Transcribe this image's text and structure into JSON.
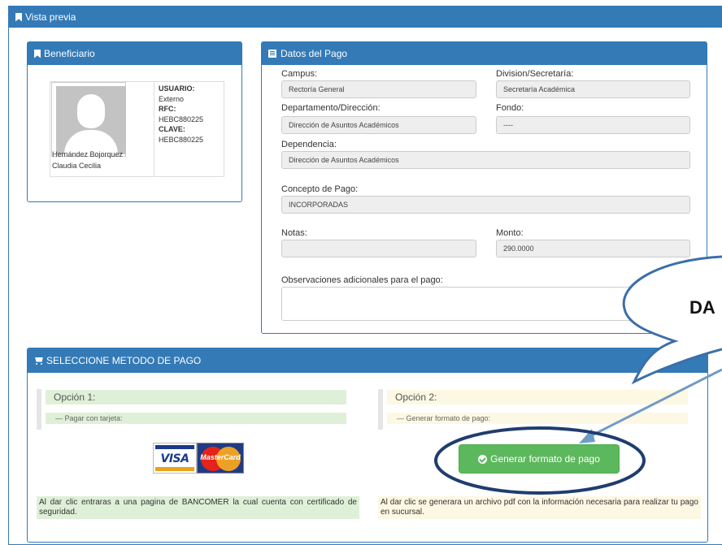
{
  "window": {
    "title": "Vista previa"
  },
  "beneficiario": {
    "title": "Beneficiario",
    "name_line1": "Hernández Bojorquez",
    "name_line2": "Claudia Cecilia",
    "usuario_label": "USUARIO:",
    "usuario_value": "Externo",
    "rfc_label": "RFC:",
    "rfc_value": "HEBC880225",
    "clave_label": "CLAVE:",
    "clave_value": "HEBC880225"
  },
  "pago": {
    "title": "Datos del Pago",
    "campus_label": "Campus:",
    "campus_value": "Rectoría General",
    "division_label": "Division/Secretaría:",
    "division_value": "Secretaría Académica",
    "departamento_label": "Departamento/Dirección:",
    "departamento_value": "Dirección de Asuntos Académicos",
    "fondo_label": "Fondo:",
    "fondo_value": "----",
    "dependencia_label": "Dependencia:",
    "dependencia_value": "Dirección de Asuntos Académicos",
    "concepto_label": "Concepto de Pago:",
    "concepto_value": "INCORPORADAS",
    "notas_label": "Notas:",
    "notas_value": "",
    "monto_label": "Monto:",
    "monto_value": "290.0000",
    "observaciones_label": "Observaciones adicionales para el pago:",
    "observaciones_value": ""
  },
  "metodo": {
    "title": "SELECCIONE METODO DE PAGO",
    "opcion1_title": "Opción 1:",
    "opcion1_sub": "— Pagar con tarjeta:",
    "visa_label": "VISA",
    "mastercard_label": "MasterCard",
    "opcion1_note": "Al dar clic entraras a una pagina de BANCOMER la cual cuenta con certificado de seguridad.",
    "opcion2_title": "Opción 2:",
    "opcion2_sub": "— Generar formato de pago:",
    "generar_button": "Generar formato de pago",
    "opcion2_note": "Al dar clic se generara un archivo pdf con la información necesaria para realizar tu pago en sucursal."
  },
  "annotation": {
    "callout_text": "DA",
    "color": "#3b6fa8"
  }
}
